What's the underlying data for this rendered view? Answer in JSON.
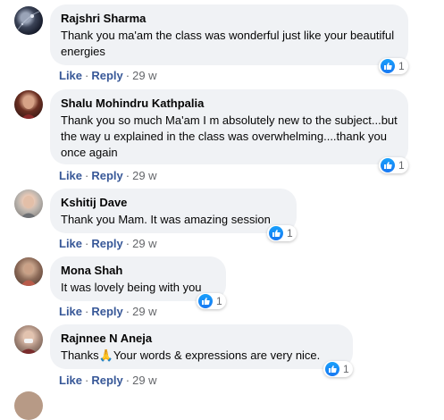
{
  "actions": {
    "like": "Like",
    "reply": "Reply",
    "separator": "·"
  },
  "comments": [
    {
      "name": "Rajshri Sharma",
      "text": "Thank you ma'am the class was wonderful just like your beautiful energies",
      "time": "29 w",
      "reactions": "1"
    },
    {
      "name": "Shalu Mohindru Kathpalia",
      "text": "Thank you so much Ma'am I m absolutely new to the subject...but the way u explained in the class was overwhelming....thank you once again",
      "time": "29 w",
      "reactions": "1"
    },
    {
      "name": "Kshitij Dave",
      "text": "Thank you Mam. It was amazing session",
      "time": "29 w",
      "reactions": "1"
    },
    {
      "name": "Mona Shah",
      "text": "It was lovely being with you",
      "time": "29 w",
      "reactions": "1"
    },
    {
      "name": "Rajnnee N Aneja",
      "text": "Thanks🙏Your words & expressions are very nice.",
      "time": "29 w",
      "reactions": "1"
    }
  ],
  "colors": {
    "bubble": "#f0f2f5",
    "action": "#385898",
    "meta": "#65676b",
    "like": "#1877f2"
  },
  "icons": {
    "reaction": "like-icon"
  }
}
